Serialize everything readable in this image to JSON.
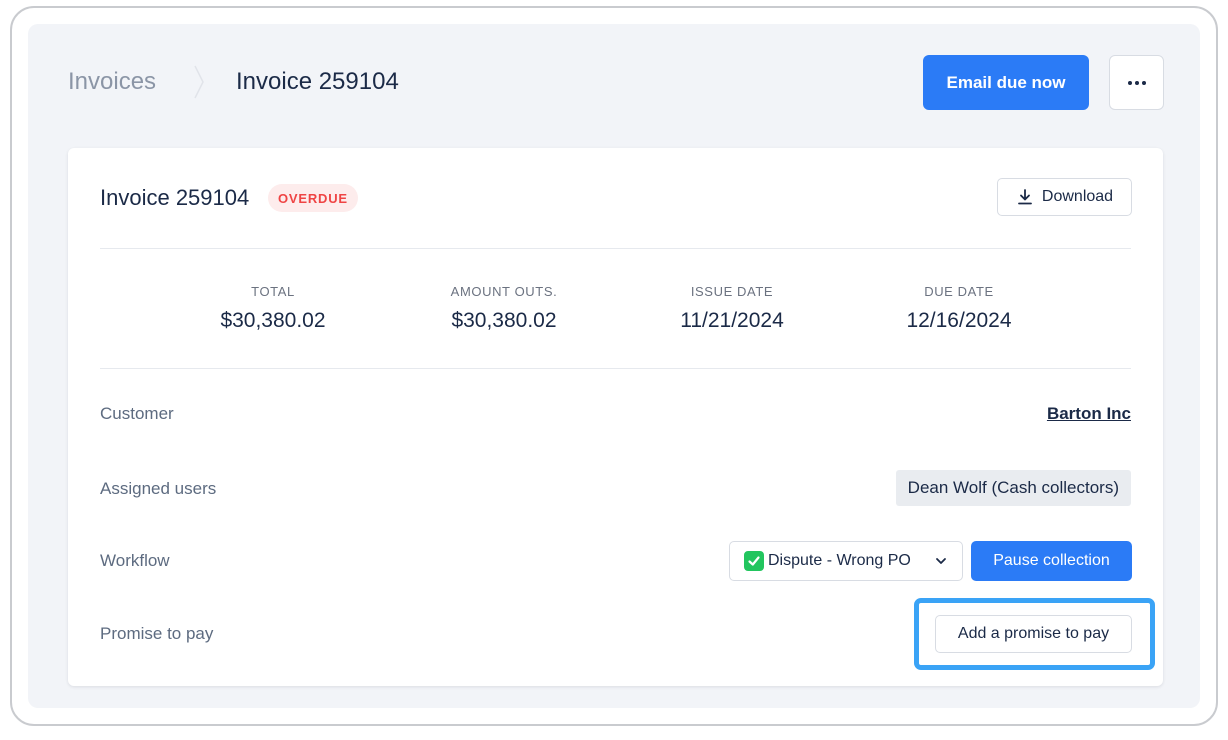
{
  "header": {
    "breadcrumb_root": "Invoices",
    "breadcrumb_current": "Invoice 259104",
    "email_button": "Email due now",
    "more_icon": "more-horizontal-icon"
  },
  "invoice": {
    "title": "Invoice 259104",
    "status_badge": "OVERDUE",
    "download_label": "Download",
    "download_icon": "download-icon"
  },
  "stats": [
    {
      "label": "TOTAL",
      "value": "$30,380.02"
    },
    {
      "label": "AMOUNT OUTS.",
      "value": "$30,380.02"
    },
    {
      "label": "ISSUE DATE",
      "value": "11/21/2024"
    },
    {
      "label": "DUE DATE",
      "value": "12/16/2024"
    }
  ],
  "details": {
    "customer_label": "Customer",
    "customer_value": "Barton Inc",
    "assigned_label": "Assigned users",
    "assigned_value": "Dean Wolf (Cash collectors)",
    "workflow_label": "Workflow",
    "workflow_value": "Dispute - Wrong PO",
    "pause_button": "Pause collection",
    "promise_label": "Promise to pay",
    "promise_button": "Add a promise to pay"
  },
  "colors": {
    "primary": "#2b7bf6",
    "overdue": "#ef4444",
    "highlight": "#3aa3f6"
  }
}
